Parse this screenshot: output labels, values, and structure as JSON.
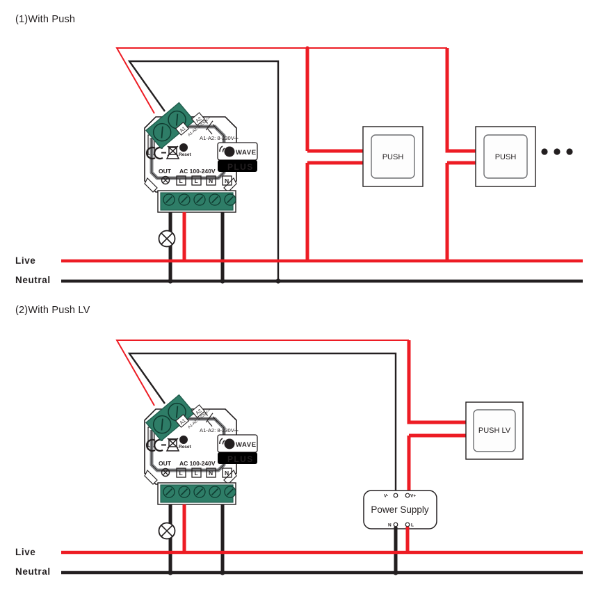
{
  "document": {
    "type": "wiring-diagram",
    "background": "#ffffff"
  },
  "colors": {
    "live_red": "#ed1c24",
    "neutral_black": "#000000",
    "terminal_green": "#2e7d67",
    "terminal_green_dark": "#1f5c4c",
    "text": "#231f20",
    "device_body": "#ffffff",
    "device_outline": "#231f20",
    "logo_black": "#000000"
  },
  "sections": [
    {
      "id": "section-1",
      "title": "(1)With Push",
      "rails": {
        "live_label": "Live",
        "neutral_label": "Neutral"
      },
      "device": {
        "name": "z-wave-plus-dimmer-module",
        "input_spec": "A1-A2: 8-230V⎓",
        "mains_label": "AC 100-240V",
        "out_label": "OUT",
        "reset_label": "Reset",
        "ce_label": "CE",
        "terminals_bottom": [
          "L",
          "L",
          "N",
          "N"
        ],
        "terminals_top": [
          "A1",
          "A2"
        ],
        "logo": {
          "brand": "WAVE",
          "mark": "Z",
          "suffix": "PLUS"
        }
      },
      "switches": [
        {
          "label": "PUSH"
        },
        {
          "label": "PUSH"
        }
      ],
      "continuation": "•••",
      "lamp": "lamp-symbol"
    },
    {
      "id": "section-2",
      "title": "(2)With Push LV",
      "rails": {
        "live_label": "Live",
        "neutral_label": "Neutral"
      },
      "device": {
        "name": "z-wave-plus-dimmer-module",
        "input_spec": "A1-A2: 8-230V⎓",
        "mains_label": "AC 100-240V",
        "out_label": "OUT",
        "reset_label": "Reset",
        "ce_label": "CE",
        "terminals_bottom": [
          "L",
          "L",
          "N",
          "N"
        ],
        "terminals_top": [
          "A1",
          "A2"
        ],
        "logo": {
          "brand": "WAVE",
          "mark": "Z",
          "suffix": "PLUS"
        }
      },
      "switches": [
        {
          "label": "PUSH LV"
        }
      ],
      "power_supply": {
        "label": "Power Supply",
        "terminals_top": [
          "V-",
          "V+"
        ],
        "terminals_bottom": [
          "N",
          "L"
        ]
      },
      "lamp": "lamp-symbol"
    }
  ]
}
